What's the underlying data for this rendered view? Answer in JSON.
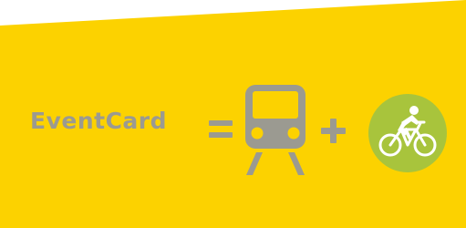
{
  "banner": {
    "title": "EventCard",
    "equation": [
      {
        "icon": "equals-icon"
      },
      {
        "icon": "train-icon"
      },
      {
        "icon": "plus-icon"
      },
      {
        "icon": "bicycle-icon"
      }
    ]
  },
  "colors": {
    "background": "#fcd200",
    "symbol_gray": "#9b9a91",
    "bike_circle": "#a8c43c",
    "page": "#ffffff"
  }
}
